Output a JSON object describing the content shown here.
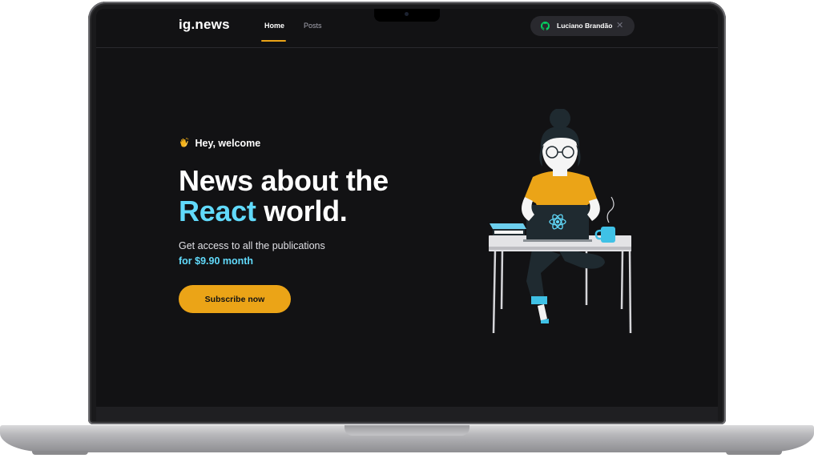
{
  "header": {
    "logo": "ig.news",
    "nav": [
      {
        "label": "Home",
        "active": true
      },
      {
        "label": "Posts",
        "active": false
      }
    ],
    "user": {
      "name": "Luciano Brandão",
      "icon": "github-icon",
      "close_icon": "close-icon"
    }
  },
  "hero": {
    "greeting": "Hey, welcome",
    "greeting_icon": "clapping-hands-icon",
    "headline_line1": "News about the",
    "headline_accent": "React",
    "headline_rest": " world.",
    "description": "Get access to all the publications",
    "price": "for $9.90 month",
    "cta": "Subscribe now",
    "illustration": "woman-with-laptop-illustration"
  },
  "colors": {
    "background": "#121214",
    "accent_yellow": "#eba417",
    "accent_cyan": "#61dafb",
    "header_button": "#29292e"
  }
}
